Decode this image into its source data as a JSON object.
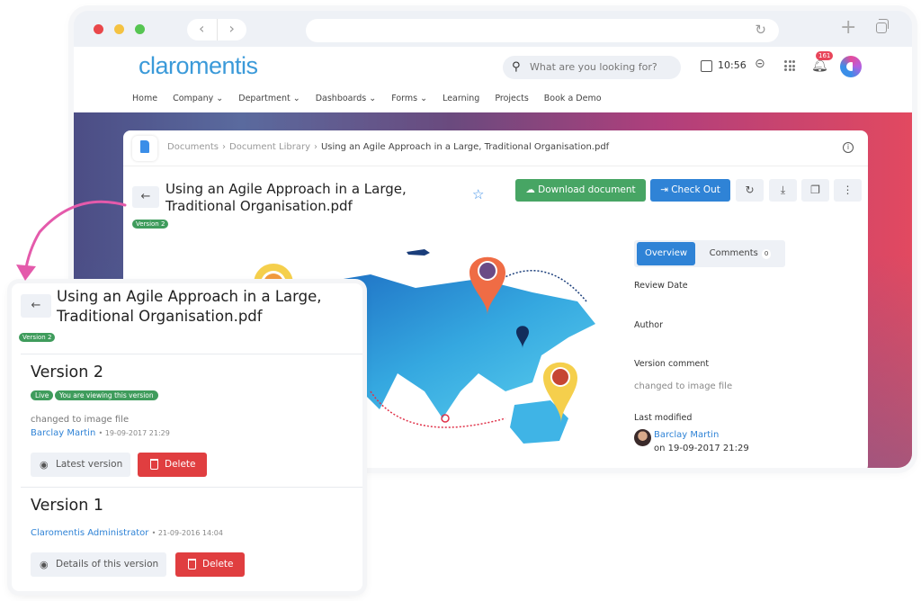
{
  "browser": {
    "traffic_lights": [
      "#e9474a",
      "#f4c242",
      "#56c552"
    ],
    "back_icon": "chevron-left-icon",
    "forward_icon": "chevron-right-icon",
    "reload_icon": "reload-icon",
    "new_tab_icon": "plus-icon",
    "tabs_icon": "tabs-icon"
  },
  "header": {
    "logo": "claromentis",
    "search_placeholder": "What are you looking for?",
    "time": "10:56",
    "notification_count": "161",
    "menu": [
      "Home",
      "Company ⌄",
      "Department ⌄",
      "Dashboards ⌄",
      "Forms ⌄",
      "Learning",
      "Projects",
      "Book a Demo"
    ]
  },
  "breadcrumb": {
    "items": [
      "Documents",
      "Document Library"
    ],
    "current": "Using an Agile Approach in a Large, Traditional Organisation.pdf",
    "separator": "›"
  },
  "document": {
    "title_line1": "Using an Agile Approach in a Large,",
    "title_line2": "Traditional Organisation.pdf",
    "version_badge": "Version 2",
    "actions": {
      "download": "Download document",
      "checkout": "Check Out",
      "refresh_icon": "↻",
      "download_icon": "⤓",
      "copy_icon": "❐",
      "more_icon": "⋮"
    }
  },
  "sidebar_panel": {
    "tabs": [
      {
        "label": "Overview",
        "active": true
      },
      {
        "label": "Comments",
        "count": "0",
        "active": false
      }
    ],
    "fields": {
      "review_date_label": "Review Date",
      "author_label": "Author",
      "version_comment_label": "Version comment",
      "version_comment_value": "changed to image file",
      "last_modified_label": "Last modified",
      "last_modified_user": "Barclay Martin",
      "last_modified_date": "on 19-09-2017 21:29"
    }
  },
  "versions_overlay": {
    "title_line1": "Using an Agile Approach in a Large,",
    "title_line2": "Traditional Organisation.pdf",
    "version_badge": "Version 2",
    "versions": [
      {
        "heading": "Version 2",
        "pills": [
          "Live",
          "You are viewing this version"
        ],
        "comment": "changed to image file",
        "user": "Barclay Martin",
        "date": "• 19-09-2017 21:29",
        "view_button": "Latest version",
        "delete_button": "Delete"
      },
      {
        "heading": "Version 1",
        "user": "Claromentis Administrator",
        "date": "• 21-09-2016 14:04",
        "view_button": "Details of this version",
        "delete_button": "Delete"
      }
    ]
  },
  "colors": {
    "brand_blue": "#2f83d6",
    "success_green": "#47a564",
    "danger_red": "#e03e40",
    "annotation_pink": "#e45aab"
  }
}
